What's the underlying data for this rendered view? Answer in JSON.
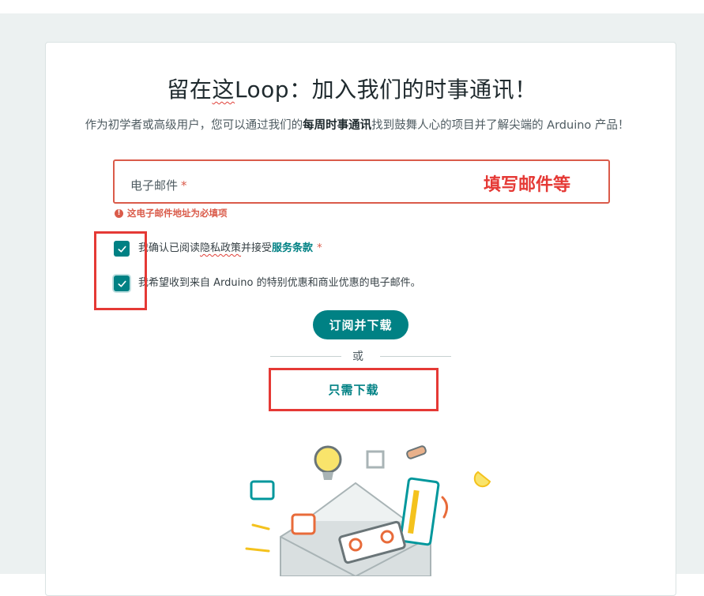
{
  "page": {
    "title_before": "留在",
    "title_squiggle": "这",
    "title_after": "Loop：加入我们的时事通讯！",
    "subtitle_before": "作为初学者或高级用户，您可以通过我们的",
    "subtitle_bold": "每周时事通讯",
    "subtitle_after": "找到鼓舞人心的项目并了解尖端的 Arduino 产品！"
  },
  "form": {
    "email_label": "电子邮件",
    "required_mark": "*",
    "email_error": "这电子邮件地址为必填项",
    "error_icon": "!",
    "consent_terms_prefix_1": "我确认已阅读",
    "consent_terms_wavy": "隐私政策",
    "consent_terms_prefix_2": "并接受",
    "consent_terms_link": "服务条款",
    "consent_offers": "我希望收到来自 Arduino 的特别优惠和商业优惠的电子邮件。",
    "subscribe_button": "订阅并下载",
    "or_text": "或",
    "download_only": "只需下载"
  },
  "annotations": {
    "email_note": "填写邮件等"
  },
  "colors": {
    "accent": "#008184",
    "error": "#da5b4a",
    "annotation": "#e53935",
    "background": "#ecf1f1"
  },
  "icons": {
    "checkbox_check": "check-icon",
    "error": "exclamation-circle-icon",
    "illustration": "arduino-envelope-illustration"
  }
}
